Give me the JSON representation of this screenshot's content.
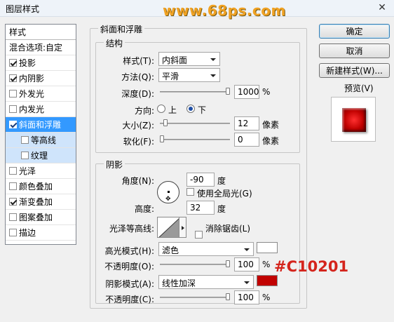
{
  "window": {
    "title": "图层样式",
    "watermark": "www.68ps.com",
    "close_glyph": "✕"
  },
  "styles_list": {
    "header": "样式",
    "blending_options": "混合选项:自定",
    "items": [
      {
        "label": "投影",
        "checked": true
      },
      {
        "label": "内阴影",
        "checked": true
      },
      {
        "label": "外发光",
        "checked": false
      },
      {
        "label": "内发光",
        "checked": false
      },
      {
        "label": "斜面和浮雕",
        "checked": true,
        "selected": true
      },
      {
        "label": "等高线",
        "checked": false,
        "sub": true
      },
      {
        "label": "纹理",
        "checked": false,
        "sub": true
      },
      {
        "label": "光泽",
        "checked": false
      },
      {
        "label": "颜色叠加",
        "checked": false
      },
      {
        "label": "渐变叠加",
        "checked": true
      },
      {
        "label": "图案叠加",
        "checked": false
      },
      {
        "label": "描边",
        "checked": false
      }
    ]
  },
  "bevel_emboss": {
    "title": "斜面和浮雕",
    "structure": {
      "title": "结构",
      "style_label": "样式(T):",
      "style_value": "内斜面",
      "technique_label": "方法(Q):",
      "technique_value": "平滑",
      "depth_label": "深度(D):",
      "depth_value": "1000",
      "depth_unit": "%",
      "depth_fraction": 1.0,
      "direction_label": "方向:",
      "direction_up": "上",
      "direction_down": "下",
      "direction_selected": "下",
      "size_label": "大小(Z):",
      "size_value": "12",
      "size_unit": "像素",
      "size_fraction": 0.05,
      "soften_label": "软化(F):",
      "soften_value": "0",
      "soften_unit": "像素",
      "soften_fraction": 0.0
    },
    "shading": {
      "title": "阴影",
      "angle_label": "角度(N):",
      "angle_value": "-90",
      "angle_unit": "度",
      "global_light_label": "使用全局光(G)",
      "global_light_checked": false,
      "altitude_label": "高度:",
      "altitude_value": "32",
      "altitude_unit": "度",
      "gloss_contour_label": "光泽等高线:",
      "anti_alias_label": "消除锯齿(L)",
      "anti_alias_checked": false,
      "highlight_mode_label": "高光模式(H):",
      "highlight_mode_value": "滤色",
      "highlight_color": "#ffffff",
      "highlight_opacity_label": "不透明度(O):",
      "highlight_opacity_value": "100",
      "highlight_opacity_fraction": 1.0,
      "shadow_mode_label": "阴影模式(A):",
      "shadow_mode_value": "线性加深",
      "shadow_color": "#c10201",
      "shadow_opacity_label": "不透明度(C):",
      "shadow_opacity_value": "100",
      "shadow_opacity_fraction": 1.0,
      "percent_unit": "%"
    }
  },
  "buttons": {
    "ok": "确定",
    "cancel": "取消",
    "new_style": "新建样式(W)...",
    "preview_label": "预览(V)",
    "preview_checked": true
  },
  "annotation": {
    "color_code": "#C10201",
    "color": "#d4241c"
  }
}
